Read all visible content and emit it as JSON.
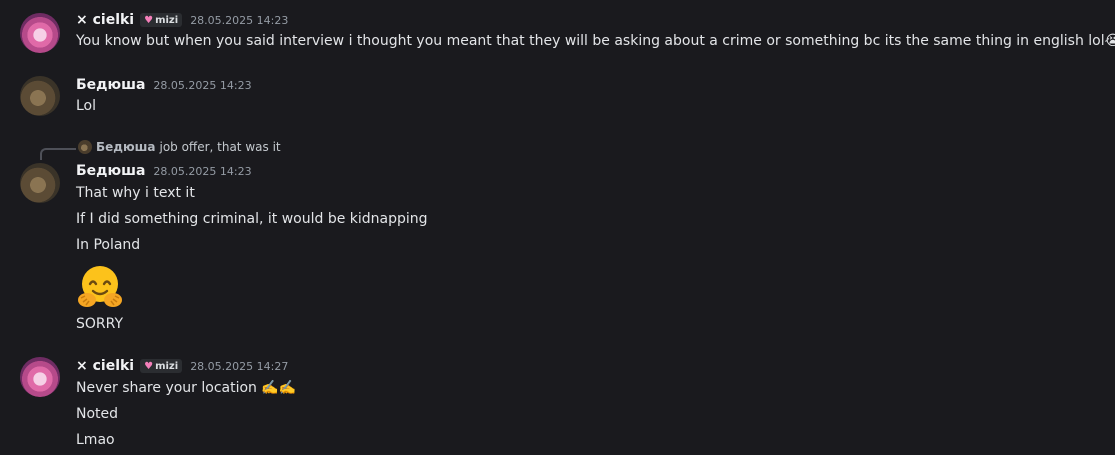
{
  "messages": [
    {
      "author": "× cielki",
      "tag": "mizi",
      "timestamp": "28.05.2025 14:23",
      "lines": [
        "You know but when you said  interview i thought you meant that they will be asking about a crime or something bc its the same thing in english lol"
      ],
      "trailing_emoji": "😭"
    },
    {
      "author": "Бедюша",
      "timestamp": "28.05.2025 14:23",
      "lines": [
        "Lol"
      ]
    },
    {
      "reply": {
        "author": "Бедюша",
        "text": "job offer, that was it"
      },
      "author": "Бедюша",
      "timestamp": "28.05.2025 14:23",
      "lines": [
        "That why i text it",
        "If I did something criminal, it would be kidnapping",
        "In Poland",
        "SORRY"
      ],
      "big_emoji": "hugging-face"
    },
    {
      "author": "× cielki",
      "tag": "mizi",
      "timestamp": "28.05.2025 14:27",
      "lines": [
        "Never share your location",
        "Noted",
        "Lmao"
      ],
      "trailing_emoji": "✍️✍️"
    }
  ],
  "colors": {
    "background": "#1a1a1e",
    "username": "#f2f3f5",
    "timestamp": "#949ba4",
    "tag_heart": "#f47fba"
  }
}
